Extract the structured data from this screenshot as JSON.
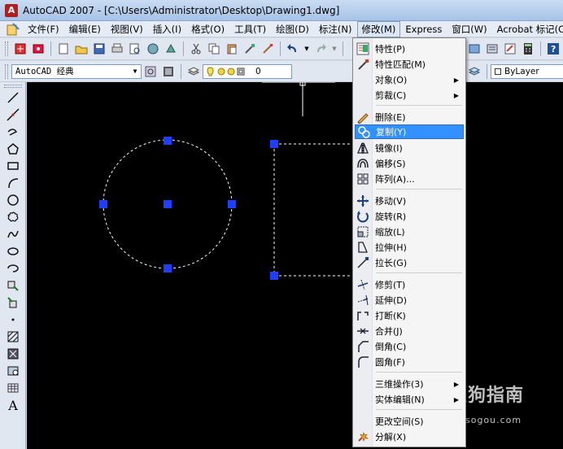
{
  "window": {
    "title": "AutoCAD 2007 - [C:\\Users\\Administrator\\Desktop\\Drawing1.dwg]"
  },
  "menubar": {
    "items": [
      {
        "label": "文件(F)"
      },
      {
        "label": "编辑(E)"
      },
      {
        "label": "视图(V)"
      },
      {
        "label": "插入(I)"
      },
      {
        "label": "格式(O)"
      },
      {
        "label": "工具(T)"
      },
      {
        "label": "绘图(D)"
      },
      {
        "label": "标注(N)"
      },
      {
        "label": "修改(M)",
        "active": true
      },
      {
        "label": "Express"
      },
      {
        "label": "窗口(W)"
      },
      {
        "label": "Acrobat 标记(C)"
      }
    ]
  },
  "toolbar2": {
    "workspace": "AutoCAD 经典",
    "layer": "0",
    "linetype": "ByLayer"
  },
  "modify_menu": {
    "items": [
      {
        "label": "特性(P)",
        "icon": "properties-icon"
      },
      {
        "label": "特性匹配(M)",
        "icon": "match-properties-icon"
      },
      {
        "label": "对象(O)",
        "submenu": true
      },
      {
        "label": "剪裁(C)",
        "submenu": true
      },
      {
        "label": "删除(E)",
        "icon": "erase-icon"
      },
      {
        "label": "复制(Y)",
        "icon": "copy-icon",
        "highlighted": true
      },
      {
        "label": "镜像(I)",
        "icon": "mirror-icon"
      },
      {
        "label": "偏移(S)",
        "icon": "offset-icon"
      },
      {
        "label": "阵列(A)...",
        "icon": "array-icon"
      },
      {
        "label": "移动(V)",
        "icon": "move-icon"
      },
      {
        "label": "旋转(R)",
        "icon": "rotate-icon"
      },
      {
        "label": "缩放(L)",
        "icon": "scale-icon"
      },
      {
        "label": "拉伸(H)",
        "icon": "stretch-icon"
      },
      {
        "label": "拉长(G)",
        "icon": "lengthen-icon"
      },
      {
        "label": "修剪(T)",
        "icon": "trim-icon"
      },
      {
        "label": "延伸(D)",
        "icon": "extend-icon"
      },
      {
        "label": "打断(K)",
        "icon": "break-icon"
      },
      {
        "label": "合并(J)",
        "icon": "join-icon"
      },
      {
        "label": "倒角(C)",
        "icon": "chamfer-icon"
      },
      {
        "label": "圆角(F)",
        "icon": "fillet-icon"
      },
      {
        "label": "三维操作(3)",
        "submenu": true
      },
      {
        "label": "实体编辑(N)",
        "submenu": true
      },
      {
        "label": "更改空间(S)"
      },
      {
        "label": "分解(X)",
        "icon": "explode-icon"
      }
    ]
  },
  "watermark": {
    "brand": "搜狗指南",
    "url": "zhinan.sogou.com"
  },
  "colors": {
    "highlight": "#3390ff",
    "grip": "#1f3fff",
    "canvas": "#000000"
  }
}
